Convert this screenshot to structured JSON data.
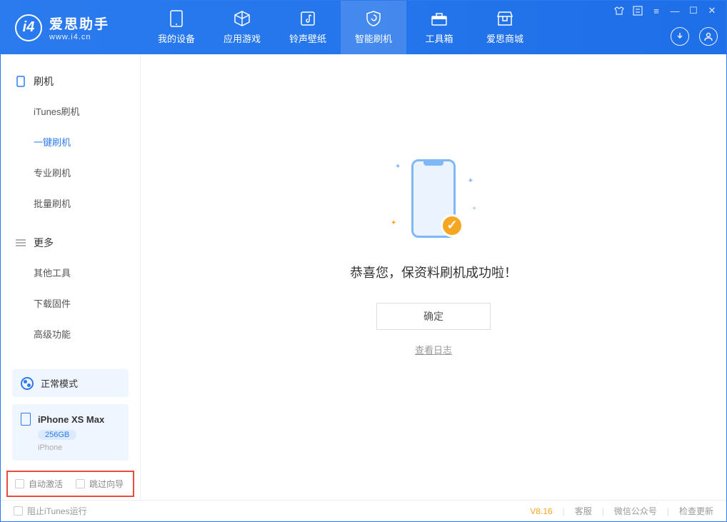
{
  "app": {
    "name": "爱思助手",
    "url": "www.i4.cn"
  },
  "nav": {
    "tabs": [
      {
        "label": "我的设备"
      },
      {
        "label": "应用游戏"
      },
      {
        "label": "铃声壁纸"
      },
      {
        "label": "智能刷机"
      },
      {
        "label": "工具箱"
      },
      {
        "label": "爱思商城"
      }
    ],
    "active_index": 3
  },
  "sidebar": {
    "groups": [
      {
        "title": "刷机",
        "items": [
          {
            "label": "iTunes刷机"
          },
          {
            "label": "一键刷机"
          },
          {
            "label": "专业刷机"
          },
          {
            "label": "批量刷机"
          }
        ],
        "active_index": 1
      },
      {
        "title": "更多",
        "items": [
          {
            "label": "其他工具"
          },
          {
            "label": "下载固件"
          },
          {
            "label": "高级功能"
          }
        ],
        "active_index": -1
      }
    ],
    "mode": "正常模式",
    "device": {
      "name": "iPhone XS Max",
      "capacity": "256GB",
      "brand": "iPhone"
    },
    "options": {
      "auto_activate": "自动激活",
      "skip_guide": "跳过向导"
    }
  },
  "main": {
    "success_message": "恭喜您，保资料刷机成功啦！",
    "confirm_button": "确定",
    "view_log": "查看日志"
  },
  "statusbar": {
    "block_itunes": "阻止iTunes运行",
    "version": "V8.16",
    "links": [
      "客服",
      "微信公众号",
      "检查更新"
    ]
  }
}
